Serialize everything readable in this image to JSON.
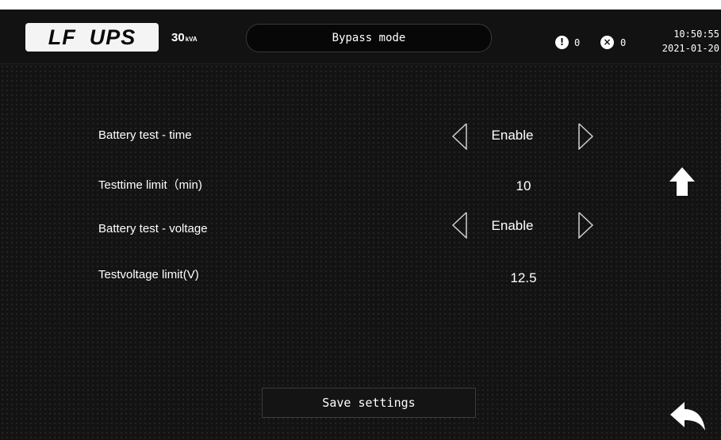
{
  "header": {
    "logo_text": "LF  UPS",
    "power_value": "30",
    "power_unit": "kVA",
    "mode": "Bypass mode",
    "warning_count": "0",
    "fault_count": "0",
    "time": "10:50:55",
    "date": "2021-01-20"
  },
  "settings": [
    {
      "label": "Battery test - time",
      "value": "Enable"
    },
    {
      "label": "Testtime limit（min)",
      "value": "10"
    },
    {
      "label": "Battery test - voltage",
      "value": "Enable"
    },
    {
      "label": "Testvoltage limit(V)",
      "value": "12.5"
    }
  ],
  "actions": {
    "save_label": "Save settings"
  },
  "icons": {
    "warning": "exclamation-circle-icon",
    "fault": "x-circle-icon",
    "up": "up-arrow-icon",
    "back": "back-arrow-icon",
    "prev": "left-arrow-icon",
    "next": "right-arrow-icon"
  },
  "colors": {
    "background": "#131313",
    "header": "#121212",
    "text": "#ffffff",
    "logo_bg": "#f4f4f4"
  }
}
